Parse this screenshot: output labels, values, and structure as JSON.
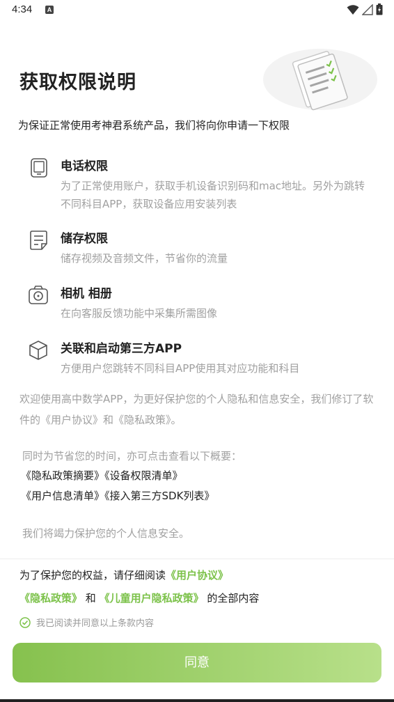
{
  "status_bar": {
    "time": "4:34",
    "notification_icon": "a-app-icon",
    "right_icons": [
      "wifi-icon",
      "signal-icon",
      "battery-icon"
    ]
  },
  "header": {
    "title": "获取权限说明",
    "illustration_icon": "document-checklist-icon"
  },
  "intro": "为保证正常使用考神君系统产品，我们将向你申请一下权限",
  "permissions": [
    {
      "icon": "phone-icon",
      "title": "电话权限",
      "desc": "为了正常使用账户，获取手机设备识别码和mac地址。另外为跳转不同科目APP，获取设备应用安装列表"
    },
    {
      "icon": "storage-icon",
      "title": "储存权限",
      "desc": "储存视频及音频文件，节省你的流量"
    },
    {
      "icon": "camera-icon",
      "title": "相机 相册",
      "desc": "在向客服反馈功能中采集所需图像"
    },
    {
      "icon": "cube-icon",
      "title": "关联和启动第三方APP",
      "desc": "方便用户您跳转不同科目APP使用其对应功能和科目"
    }
  ],
  "welcome_text": "欢迎使用高中数学APP，为更好保护您的个人隐私和信息安全，我们修订了软件的《用户协议》和《隐私政策》。",
  "summary_intro": "同时为节省您的时间，亦可点击查看以下概要：",
  "summary_links": {
    "privacy_summary": "《隐私政策摘要》",
    "device_permissions": "《设备权限清单》",
    "user_info_list": "《用户信息清单》",
    "third_party_sdk": "《接入第三方SDK列表》"
  },
  "protect_text": "我们将竭力保护您的个人信息安全。",
  "consent": {
    "prefix": "为了保护您的权益，请仔细阅读",
    "user_agreement": "《用户协议》",
    "privacy_policy": "《隐私政策》",
    "conjunction": "和",
    "child_privacy": "《儿童用户隐私政策》",
    "suffix": "的全部内容",
    "checkbox_label": "我已阅读并同意以上条款内容"
  },
  "agree_button": "同意",
  "colors": {
    "accent": "#7cc24a",
    "button_start": "#86c14e",
    "button_end": "#b8e08a",
    "muted_text": "#a0a0a0"
  }
}
